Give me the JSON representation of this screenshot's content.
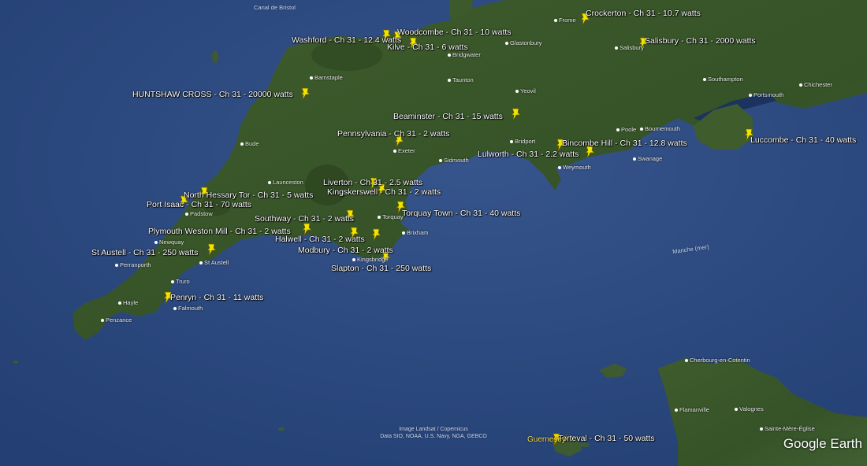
{
  "brand": "Google Earth",
  "credits": [
    "Image Landsat / Copernicus",
    "Data SIO, NOAA, U.S. Navy, NGA, GEBCO"
  ],
  "sea_labels": {
    "bristol_channel": "Canal de Bristol",
    "manche": "Manche (mer)"
  },
  "island_label": "Guernesey",
  "colors": {
    "sea": "#2f4d82",
    "land": "#3c5a2c",
    "pin": "#f2e600",
    "label": "#ffffff"
  },
  "icons": {
    "pin": "pushpin-icon",
    "town": "town-dot-icon"
  },
  "transmitters": [
    "Crockerton - Ch 31 - 10.7 watts",
    "Woodcombe - Ch 31 - 10 watts",
    "Washford - Ch 31 - 12.4 watts",
    "Kilve - Ch 31 - 6 watts",
    "Salisbury - Ch 31 - 2000 watts",
    "HUNTSHAW CROSS - Ch 31 - 20000 watts",
    "Beaminster - Ch 31 - 15 watts",
    "Pennsylvania - Ch 31 - 2 watts",
    "Bincombe Hill - Ch 31 - 12.8 watts",
    "Lulworth - Ch 31 - 2.2 watts",
    "Luccombe - Ch 31 - 40 watts",
    "Liverton - Ch 31 - 2.5 watts",
    "Kingskerswell - Ch 31 - 2 watts",
    "North Hessary Tor - Ch 31 - 5 watts",
    "Port Isaac - Ch 31 - 70 watts",
    "Torquay Town - Ch 31 - 40 watts",
    "Southway - Ch 31 - 2 watts",
    "Plymouth Weston Mill - Ch 31 - 2 watts",
    "Halwell - Ch 31 - 2 watts",
    "St Austell - Ch 31 - 250 watts",
    "Modbury - Ch 31 - 2 watts",
    "Slapton - Ch 31 - 250 watts",
    "Penryn - Ch 31 - 11 watts",
    "Torteval - Ch 31 - 50 watts"
  ],
  "towns": [
    "Frome",
    "Glastonbury",
    "Bridgwater",
    "Salisbury",
    "Barnstaple",
    "Taunton",
    "Yeovil",
    "Southampton",
    "Portsmouth",
    "Chichester",
    "Bude",
    "Exeter",
    "Bridport",
    "Poole",
    "Bournemouth",
    "Sidmouth",
    "Weymouth",
    "Swanage",
    "Launceston",
    "Padstow",
    "Torquay",
    "Brixham",
    "Newquay",
    "Perranporth",
    "St Austell",
    "Kingsbridge",
    "Truro",
    "Hayle",
    "Falmouth",
    "Penzance",
    "Cherbourg-en-Cotentin",
    "Flamanville",
    "Valognes",
    "Sainte-Mère-Église"
  ]
}
